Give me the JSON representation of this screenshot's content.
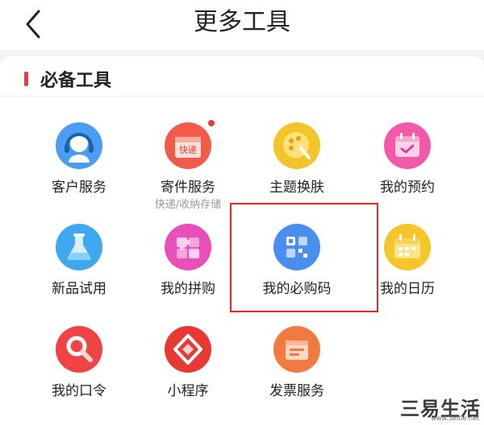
{
  "header": {
    "title": "更多工具"
  },
  "section": {
    "title": "必备工具"
  },
  "tools": [
    {
      "label": "客户服务",
      "icon": "headset-icon"
    },
    {
      "label": "寄件服务",
      "sub": "快递/收纳存储",
      "icon": "express-box-icon",
      "icon_text": "快递",
      "has_badge": true
    },
    {
      "label": "主题换肤",
      "icon": "palette-icon"
    },
    {
      "label": "我的预约",
      "icon": "calendar-check-icon"
    },
    {
      "label": "新品试用",
      "icon": "flask-icon"
    },
    {
      "label": "我的拼购",
      "icon": "puzzle-icon"
    },
    {
      "label": "我的必购码",
      "icon": "qr-code-icon"
    },
    {
      "label": "我的日历",
      "icon": "calendar-icon"
    },
    {
      "label": "我的口令",
      "icon": "magnifier-icon"
    },
    {
      "label": "小程序",
      "icon": "mini-program-icon"
    },
    {
      "label": "发票服务",
      "icon": "invoice-icon"
    }
  ],
  "watermark": {
    "main": "三易生活",
    "sub": "www.3eltie.net"
  },
  "colors": {
    "accent": "#e93b3d",
    "highlight": "#e8262a"
  }
}
